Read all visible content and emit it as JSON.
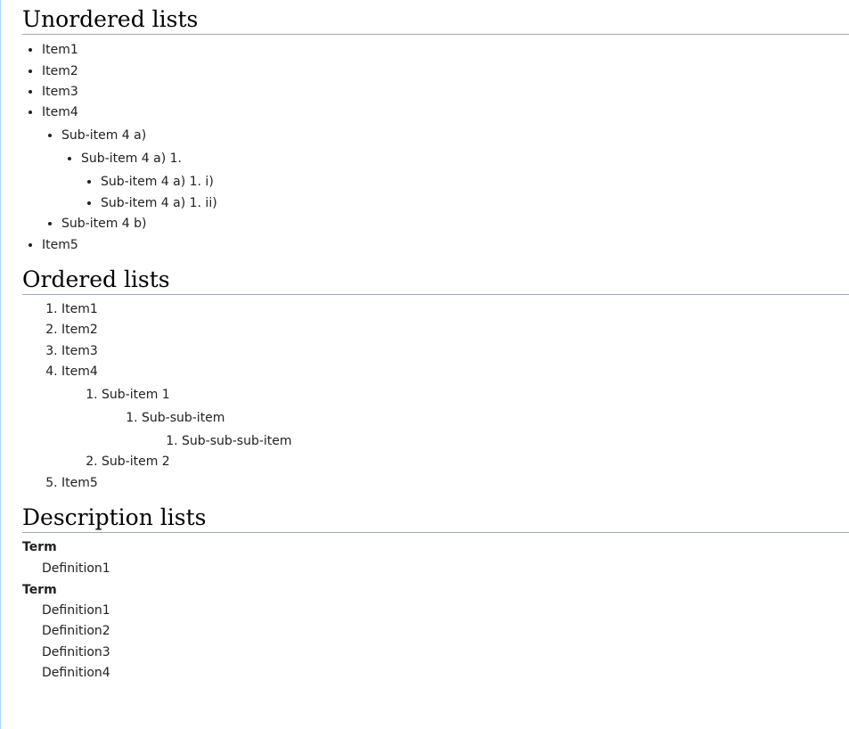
{
  "sections": {
    "unordered": {
      "heading": "Unordered lists",
      "items": [
        "Item1",
        "Item2",
        "Item3",
        "Item4",
        "Item5"
      ],
      "sub4": {
        "a": "Sub-item 4 a)",
        "a1": "Sub-item 4 a) 1.",
        "a1i": "Sub-item 4 a) 1. i)",
        "a1ii": "Sub-item 4 a) 1. ii)",
        "b": "Sub-item 4 b)"
      }
    },
    "ordered": {
      "heading": "Ordered lists",
      "items": [
        "Item1",
        "Item2",
        "Item3",
        "Item4",
        "Item5"
      ],
      "sub": {
        "sub1": "Sub-item 1",
        "subsub": "Sub-sub-item",
        "subsubsub": "Sub-sub-sub-item",
        "sub2": "Sub-item 2"
      }
    },
    "description": {
      "heading": "Description lists",
      "groups": [
        {
          "term": "Term",
          "definitions": [
            "Definition1"
          ]
        },
        {
          "term": "Term",
          "definitions": [
            "Definition1",
            "Definition2",
            "Definition3",
            "Definition4"
          ]
        }
      ]
    }
  },
  "colors": {
    "text": "#202122",
    "heading_rule": "#a2a9b1",
    "left_rule": "#a7d7f9"
  }
}
